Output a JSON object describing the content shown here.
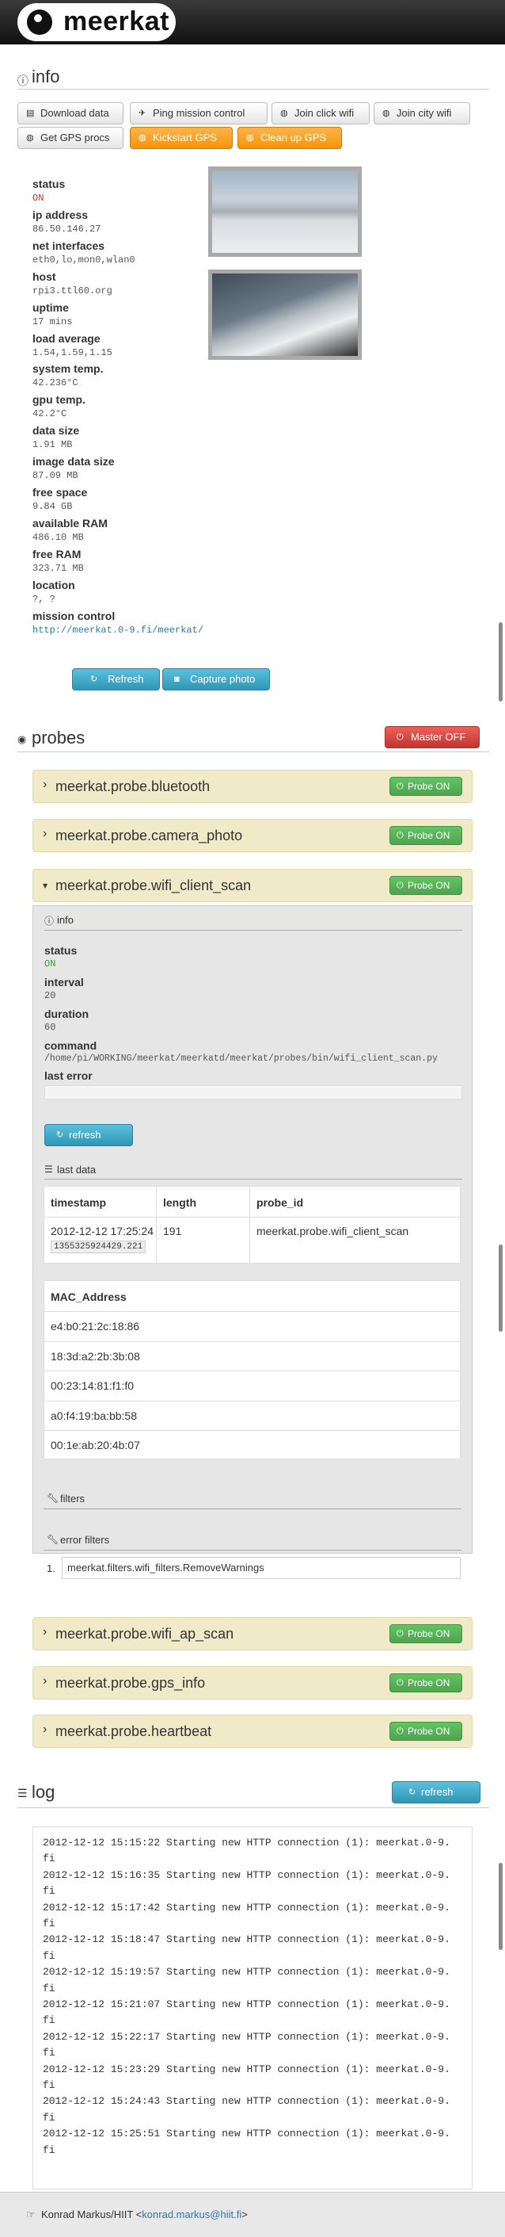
{
  "app": {
    "name": "meerkat"
  },
  "info": {
    "title": "info",
    "buttons": [
      "Download data",
      "Ping mission control",
      "Join click wifi",
      "Join city wifi",
      "Get GPS procs",
      "Kickstart GPS",
      "Clean up GPS"
    ],
    "fields": [
      {
        "label": "status",
        "value": "ON"
      },
      {
        "label": "ip address",
        "value": "86.50.146.27"
      },
      {
        "label": "net interfaces",
        "value": "eth0,lo,mon0,wlan0"
      },
      {
        "label": "host",
        "value": "rpi3.ttl60.org"
      },
      {
        "label": "uptime",
        "value": "17 mins"
      },
      {
        "label": "load average",
        "value": "1.54,1.59,1.15"
      },
      {
        "label": "system temp.",
        "value": "42.236°C"
      },
      {
        "label": "gpu temp.",
        "value": "42.2°C"
      },
      {
        "label": "data size",
        "value": "1.91 MB"
      },
      {
        "label": "image data size",
        "value": "87.09 MB"
      },
      {
        "label": "free space",
        "value": "9.84 GB"
      },
      {
        "label": "available RAM",
        "value": "486.10 MB"
      },
      {
        "label": "free RAM",
        "value": "323.71 MB"
      },
      {
        "label": "location",
        "value": "?, ?"
      },
      {
        "label": "mission control",
        "value": "http://meerkat.0-9.fi/meerkat/"
      }
    ],
    "refresh": "Refresh",
    "capture": "Capture photo"
  },
  "probes": {
    "title": "probes",
    "master": "Master OFF",
    "probe_on": "Probe ON",
    "list": [
      "meerkat.probe.bluetooth",
      "meerkat.probe.camera_photo",
      "meerkat.probe.wifi_client_scan",
      "meerkat.probe.wifi_ap_scan",
      "meerkat.probe.gps_info",
      "meerkat.probe.heartbeat"
    ],
    "detail": {
      "info_title": "info",
      "status_label": "status",
      "status": "ON",
      "interval_label": "interval",
      "interval": "20",
      "duration_label": "duration",
      "duration": "60",
      "command_label": "command",
      "command": "/home/pi/WORKING/meerkat/meerkatd/meerkat/probes/bin/wifi_client_scan.py",
      "last_error_label": "last error",
      "refresh": "refresh",
      "last_data_title": "last data",
      "headers": [
        "timestamp",
        "length",
        "probe_id"
      ],
      "row": {
        "timestamp": "2012-12-12 17:25:24",
        "epoch": "1355325924429.221",
        "length": "191",
        "probe_id": "meerkat.probe.wifi_client_scan"
      },
      "mac_header": "MAC_Address",
      "macs": [
        "e4:b0:21:2c:18:86",
        "18:3d:a2:2b:3b:08",
        "00:23:14:81:f1:f0",
        "a0:f4:19:ba:bb:58",
        "00:1e:ab:20:4b:07"
      ],
      "filters_title": "filters",
      "error_filters_title": "error filters",
      "error_filters": [
        "meerkat.filters.wifi_filters.RemoveWarnings"
      ]
    }
  },
  "log": {
    "title": "log",
    "refresh": "refresh",
    "lines": [
      "2012-12-12 15:15:22 Starting new HTTP connection (1): meerkat.0-9.",
      "fi",
      "2012-12-12 15:16:35 Starting new HTTP connection (1): meerkat.0-9.",
      "fi",
      "2012-12-12 15:17:42 Starting new HTTP connection (1): meerkat.0-9.",
      "fi",
      "2012-12-12 15:18:47 Starting new HTTP connection (1): meerkat.0-9.",
      "fi",
      "2012-12-12 15:19:57 Starting new HTTP connection (1): meerkat.0-9.",
      "fi",
      "2012-12-12 15:21:07 Starting new HTTP connection (1): meerkat.0-9.",
      "fi",
      "2012-12-12 15:22:17 Starting new HTTP connection (1): meerkat.0-9.",
      "fi",
      "2012-12-12 15:23:29 Starting new HTTP connection (1): meerkat.0-9.",
      "fi",
      "2012-12-12 15:24:43 Starting new HTTP connection (1): meerkat.0-9.",
      "fi",
      "2012-12-12 15:25:51 Starting new HTTP connection (1): meerkat.0-9.",
      "fi"
    ]
  },
  "footer": {
    "author": "Konrad Markus/HIIT <",
    "email": "konrad.markus@hiit.fi",
    ">": ">"
  }
}
